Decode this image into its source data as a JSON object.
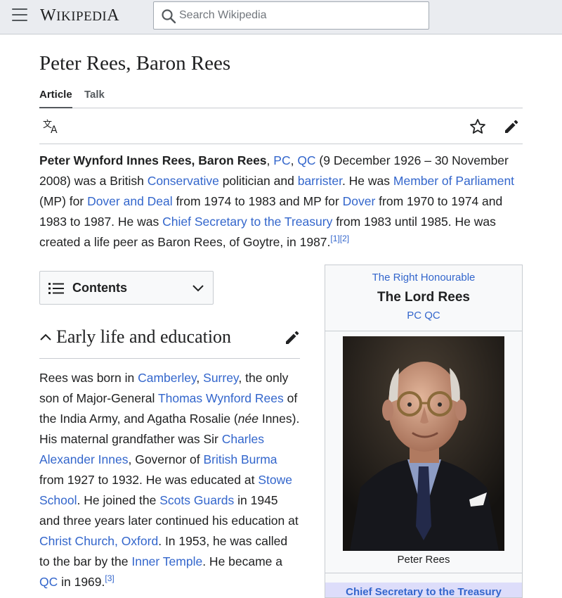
{
  "header": {
    "logo_big_w": "W",
    "logo_rest": "IKIPEDI",
    "logo_big_a": "A",
    "search_placeholder": "Search Wikipedia"
  },
  "page": {
    "title": "Peter Rees, Baron Rees",
    "tabs": [
      {
        "label": "Article",
        "active": true
      },
      {
        "label": "Talk",
        "active": false
      }
    ]
  },
  "intro": {
    "bold_name": "Peter Wynford Innes Rees, Baron Rees",
    "t1": ", ",
    "l_pc": "PC",
    "t2": ", ",
    "l_qc": "QC",
    "t3": " (9 December 1926 – 30 November 2008) was a British ",
    "l_conservative": "Conservative",
    "t4": " politician and ",
    "l_barrister": "barrister",
    "t5": ". He was ",
    "l_mp": "Member of Parliament",
    "t6": " (MP) for ",
    "l_dover_deal": "Dover and Deal",
    "t7": " from 1974 to 1983 and MP for ",
    "l_dover": "Dover",
    "t8": " from 1970 to 1974 and 1983 to 1987. He was ",
    "l_chief_sec": "Chief Secretary to the Treasury",
    "t9": " from 1983 until 1985. He was created a life peer as Baron Rees, of Goytre, in 1987.",
    "ref1": "[1]",
    "ref2": "[2]"
  },
  "toc": {
    "label": "Contents"
  },
  "section": {
    "heading": "Early life and education",
    "s1": "Rees was born in ",
    "l_camberley": "Camberley",
    "s2": ", ",
    "l_surrey": "Surrey",
    "s3": ", the only son of Major-General ",
    "l_thomas": "Thomas Wynford Rees",
    "s4": " of the India Army, and Agatha Rosalie (",
    "nee": "née",
    "s5": " Innes). His maternal grandfather was Sir ",
    "l_charles": "Charles Alexander Innes",
    "s6": ", Governor of ",
    "l_burma": "British Burma",
    "s7": " from 1927 to 1932. He was educated at ",
    "l_stowe": "Stowe School",
    "s8": ". He joined the ",
    "l_scots": "Scots Guards",
    "s9": " in 1945 and three years later continued his education at ",
    "l_christ": "Christ Church, Oxford",
    "s10": ". In 1953, he was called to the bar by the ",
    "l_inner": "Inner Temple",
    "s11": ". He became a ",
    "l_qc2": "QC",
    "s12": " in 1969.",
    "ref3": "[3]"
  },
  "infobox": {
    "honorific": "The Right Honourable",
    "name": "The Lord Rees",
    "post_nominals": "PC QC",
    "caption": "Peter Rees",
    "office": "Chief Secretary to the Treasury"
  },
  "colors": {
    "link": "#3366cc",
    "header_bg": "#eaecf0",
    "infobox_office_bg": "#ddddfa"
  }
}
